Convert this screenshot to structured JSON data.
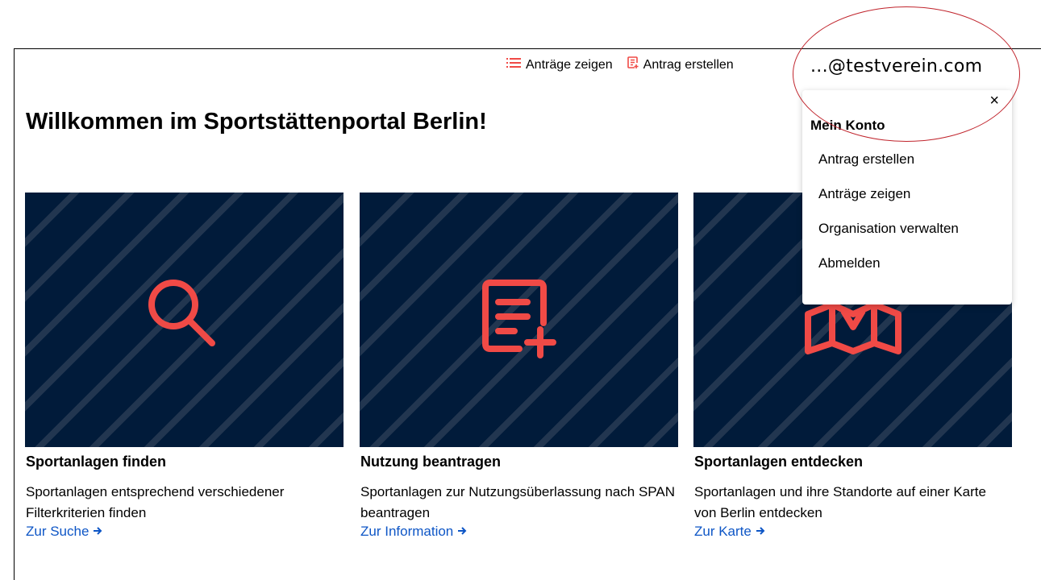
{
  "header": {
    "nav_antraege_zeigen": "Anträge zeigen",
    "nav_antrag_erstellen": "Antrag erstellen",
    "user_email": "...@testverein.com"
  },
  "page": {
    "title": "Willkommen im Sportstättenportal Berlin!"
  },
  "cards": [
    {
      "title": "Sportanlagen finden",
      "text": "Sportanlagen entsprechend verschiedener Filterkriterien finden",
      "link": "Zur Suche",
      "icon": "search-icon"
    },
    {
      "title": "Nutzung beantragen",
      "text": "Sportanlagen zur Nutzungsüberlassung nach SPAN beantragen",
      "link": "Zur Information",
      "icon": "document-add-icon"
    },
    {
      "title": "Sportanlagen entdecken",
      "text": "Sportanlagen und ihre Standorte auf einer Karte von Berlin entdecken",
      "link": "Zur Karte",
      "icon": "map-icon"
    }
  ],
  "account_menu": {
    "close": "×",
    "title": "Mein Konto",
    "items": [
      "Antrag erstellen",
      "Anträge zeigen",
      "Organisation verwalten",
      "Abmelden"
    ]
  },
  "colors": {
    "accent": "#f04a46",
    "card_bg": "#011b3a",
    "link": "#0e56c6",
    "annotation": "#c0242c"
  }
}
